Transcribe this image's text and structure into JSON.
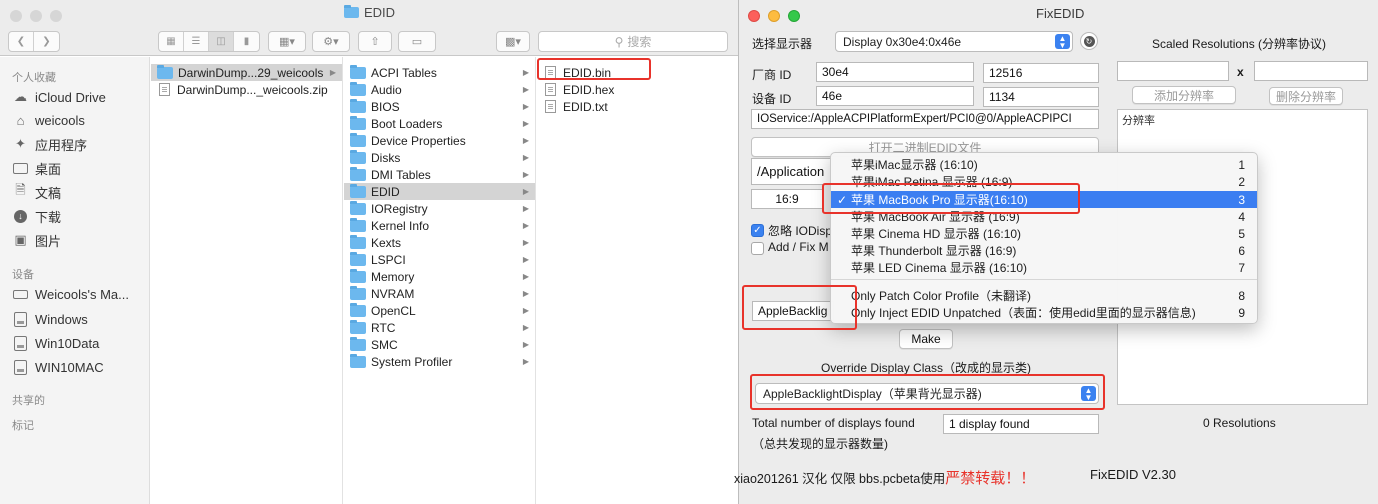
{
  "finder": {
    "title": "EDID",
    "search_placeholder": "搜索",
    "sidebar": {
      "sections": {
        "favorites": "个人收藏",
        "devices": "设备",
        "shared": "共享的",
        "tags": "标记"
      },
      "favorites": [
        {
          "label": "iCloud Drive",
          "icon": "cloud-icon"
        },
        {
          "label": "weicools",
          "icon": "home-icon"
        },
        {
          "label": "应用程序",
          "icon": "applications-icon"
        },
        {
          "label": "桌面",
          "icon": "desktop-icon"
        },
        {
          "label": "文稿",
          "icon": "documents-icon"
        },
        {
          "label": "下载",
          "icon": "downloads-icon"
        },
        {
          "label": "图片",
          "icon": "pictures-icon"
        }
      ],
      "devices": [
        {
          "label": "Weicools's Ma...",
          "icon": "laptop-icon"
        },
        {
          "label": "Windows",
          "icon": "disk-icon"
        },
        {
          "label": "Win10Data",
          "icon": "disk-icon"
        },
        {
          "label": "WIN10MAC",
          "icon": "disk-icon"
        }
      ]
    },
    "column1": [
      {
        "label": "DarwinDump...29_weicools",
        "type": "folder",
        "selected": true,
        "arrow": true
      },
      {
        "label": "DarwinDump..._weicools.zip",
        "type": "file",
        "selected": false,
        "arrow": false
      }
    ],
    "column2": [
      {
        "label": "ACPI Tables"
      },
      {
        "label": "Audio"
      },
      {
        "label": "BIOS"
      },
      {
        "label": "Boot Loaders"
      },
      {
        "label": "Device Properties"
      },
      {
        "label": "Disks"
      },
      {
        "label": "DMI Tables"
      },
      {
        "label": "EDID"
      },
      {
        "label": "IORegistry"
      },
      {
        "label": "Kernel Info"
      },
      {
        "label": "Kexts"
      },
      {
        "label": "LSPCI"
      },
      {
        "label": "Memory"
      },
      {
        "label": "NVRAM"
      },
      {
        "label": "OpenCL"
      },
      {
        "label": "RTC"
      },
      {
        "label": "SMC"
      },
      {
        "label": "System Profiler"
      }
    ],
    "column2_selected_index": 7,
    "column3": [
      {
        "label": "EDID.bin"
      },
      {
        "label": "EDID.hex"
      },
      {
        "label": "EDID.txt"
      }
    ]
  },
  "fixedid": {
    "title": "FixEDID",
    "select_display_label": "选择显示器",
    "display_popup": "Display 0x30e4:0x46e",
    "scaled_res_title": "Scaled Resolutions (分辨率协议)",
    "vendor_label": "厂商 ID",
    "vendor_hex": "30e4",
    "vendor_dec": "12516",
    "device_label": "设备 ID",
    "device_hex": "46e",
    "device_dec": "1134",
    "ioservice_path": "IOService:/AppleACPIPlatformExpert/PCI0@0/AppleACPIPCI",
    "open_binary_button": "打开二进制EDID文件",
    "applications_path": "/Application",
    "aspect_value": "16:9",
    "ignore_label": "忽略 IODisp",
    "add_fix_label": "Add / Fix M",
    "backlight_field": "AppleBacklig",
    "make_button": "Make",
    "override_label": "Override Display Class（改成的显示类)",
    "override_popup": "AppleBacklightDisplay（苹果背光显示器)",
    "total_label": "Total number of displays found",
    "total_label_cn": "（总共发现的显示器数量)",
    "displays_found": "1 display found",
    "res_x_sep": "x",
    "add_res_button": "添加分辨率",
    "del_res_button": "删除分辨率",
    "res_list_header": "分辨率",
    "res_count": "0 Resolutions",
    "footer_credit": "xiao201261 汉化 仅限 bbs.pcbeta使用",
    "footer_warning": "严禁转载！！",
    "version": "FixEDID V2.30"
  },
  "menu": {
    "items": [
      {
        "label": "苹果iMac显示器 (16:10)",
        "num": "1",
        "checked": false
      },
      {
        "label": "苹果iMac Retina 显示器 (16:9)",
        "num": "2",
        "checked": false
      },
      {
        "label": "苹果 MacBook Pro 显示器(16:10)",
        "num": "3",
        "checked": true
      },
      {
        "label": "苹果 MacBook Air 显示器 (16:9)",
        "num": "4",
        "checked": false
      },
      {
        "label": "苹果 Cinema HD 显示器 (16:10)",
        "num": "5",
        "checked": false
      },
      {
        "label": "苹果 Thunderbolt 显示器 (16:9)",
        "num": "6",
        "checked": false
      },
      {
        "label": "苹果 LED Cinema 显示器 (16:10)",
        "num": "7",
        "checked": false
      },
      {
        "label": "Only Patch Color Profile（未翻译)",
        "num": "8",
        "checked": false
      },
      {
        "label": "Only Inject EDID Unpatched（表面：使用edid里面的显示器信息)",
        "num": "9",
        "checked": false
      }
    ],
    "check_glyph": "✓"
  },
  "colors": {
    "highlight": "#3b7ef1",
    "annotation_red": "#e8332b",
    "folder_blue": "#6cb8ee",
    "warning_red": "#e8332b"
  }
}
